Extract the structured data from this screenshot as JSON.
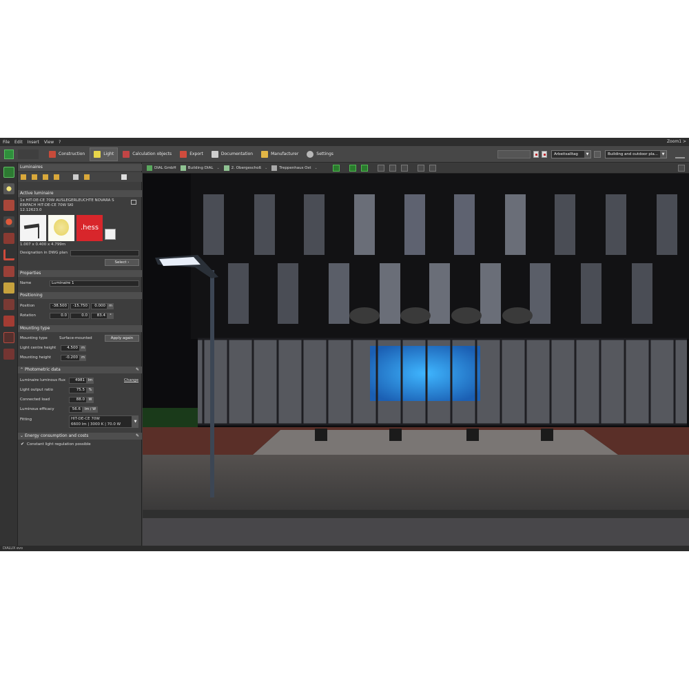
{
  "menu": [
    "File",
    "Edit",
    "Insert",
    "View",
    "?"
  ],
  "zoom_label": "Zoom1 >",
  "ribbon_tabs": [
    {
      "label": "Construction",
      "color": "#c84b3a"
    },
    {
      "label": "Light",
      "color": "#e8d64a"
    },
    {
      "label": "Calculation objects",
      "color": "#c24545"
    },
    {
      "label": "Export",
      "color": "#d14c3d"
    },
    {
      "label": "Documentation",
      "color": "#cfcfcf"
    },
    {
      "label": "Manufacturer",
      "color": "#e2b646"
    },
    {
      "label": "Settings",
      "color": "#b8b8b8"
    }
  ],
  "ribbon_right": {
    "schedule": "Arbeitsalltag",
    "profile": "Building and outdoor pla..."
  },
  "panel": {
    "header": "Luminaires",
    "active_section": "Active luminaire",
    "luminaire_desc_line1": "1x HIT-DE-CE 70W AUSLEGERLEUCHTE NOVARA S",
    "luminaire_desc_line2": "EINFACH HIT-DE-CE 70W SKI",
    "luminaire_code": "12.12623.0",
    "brand": ".hess",
    "dimensions": "1.007 x 0.400 x 4.799m",
    "designation_label": "Designation in DWG plan",
    "select_btn": "Select",
    "properties_section": "Properties",
    "name_label": "Name",
    "name_value": "Luminaire 1",
    "positioning_section": "Positioning",
    "position_label": "Position",
    "position_values": [
      "-38.500",
      "-15.750",
      "0.000"
    ],
    "position_unit": "m",
    "rotation_label": "Rotation",
    "rotation_values": [
      "0.0",
      "0.0",
      "83.4"
    ],
    "rotation_unit": "°",
    "mounting_section": "Mounting type",
    "mounting_type_label": "Mounting type",
    "mounting_type_value": "Surface-mounted",
    "apply_btn": "Apply again",
    "lch_label": "Light centre height",
    "lch_value": "4.500",
    "mh_label": "Mounting height",
    "mh_value": "-0.200",
    "len_unit": "m",
    "photometric_section": "Photometric data",
    "flux_label": "Luminaire luminous flux",
    "flux_value": "4981",
    "flux_unit": "lm",
    "change_link": "Change",
    "lor_label": "Light output ratio",
    "lor_value": "75.5",
    "lor_unit": "%",
    "load_label": "Connected load",
    "load_value": "88.0",
    "load_unit": "W",
    "eff_label": "Luminous efficacy",
    "eff_value": "56.6",
    "eff_unit": "lm / W",
    "fitting_label": "Fitting",
    "fitting_line1": "HIT-DE-CE 70W",
    "fitting_line2": "6600 lm  |  3000 K  |  70.0 W",
    "energy_section": "Energy consumption and costs",
    "constant_label": "Constant light regulation possible"
  },
  "viewport_toolbar": {
    "crumbs": [
      "DIAL GmbH",
      "Building DIAL",
      "2. Obergeschoß",
      "Treppenhaus Ost"
    ]
  },
  "status_text": "DIALUX evo"
}
